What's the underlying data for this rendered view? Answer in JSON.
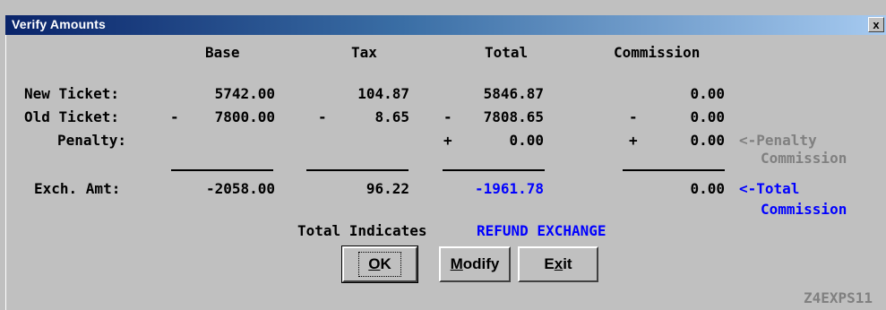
{
  "window": {
    "title": "Verify Amounts",
    "close_label": "x"
  },
  "headers": {
    "base": "Base",
    "tax": "Tax",
    "total": "Total",
    "commission": "Commission"
  },
  "rows": {
    "new_ticket": {
      "label": "New Ticket:",
      "base": "5742.00",
      "tax": "104.87",
      "total": "5846.87",
      "commission": "0.00"
    },
    "old_ticket": {
      "label": "Old Ticket:",
      "base_sign": "-",
      "base": "7800.00",
      "tax_sign": "-",
      "tax": "8.65",
      "total_sign": "-",
      "total": "7808.65",
      "commission_sign": "-",
      "commission": "0.00"
    },
    "penalty": {
      "label": "Penalty:",
      "total_sign": "+",
      "total": "0.00",
      "commission_sign": "+",
      "commission": "0.00",
      "note_line1": "<-Penalty",
      "note_line2": "Commission"
    },
    "exch_amt": {
      "label": "Exch. Amt:",
      "base": "-2058.00",
      "tax": "96.22",
      "total": "-1961.78",
      "commission": "0.00",
      "note_line1": "<-Total",
      "note_line2": "Commission"
    }
  },
  "indicator": {
    "prefix": "Total Indicates",
    "value": "REFUND EXCHANGE"
  },
  "buttons": {
    "ok": {
      "mnemonic": "O",
      "rest": "K"
    },
    "modify": {
      "mnemonic": "M",
      "rest": "odify"
    },
    "exit": {
      "pre": "E",
      "mnemonic": "x",
      "rest": "it"
    }
  },
  "screen_id": "Z4EXPS11",
  "colors": {
    "title_start": "#0a246a",
    "title_end": "#a6caf0",
    "blue_text": "#0000ff",
    "grey_text": "#808080",
    "background": "#c0c0c0"
  }
}
